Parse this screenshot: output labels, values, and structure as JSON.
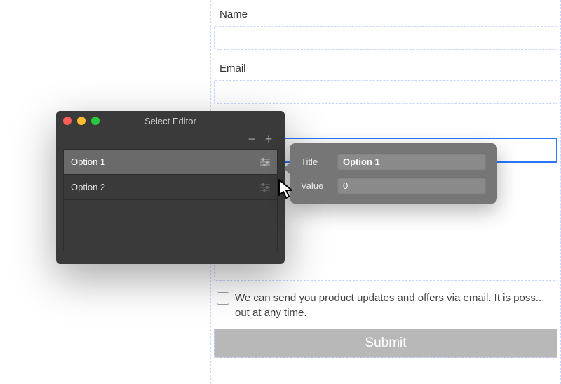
{
  "form": {
    "name_label": "Name",
    "email_label": "Email",
    "checkbox_text": "We can send you product updates and offers via email. It is poss... out at any time.",
    "submit_label": "Submit"
  },
  "editor": {
    "window_title": "Select Editor",
    "options": [
      {
        "label": "Option 1"
      },
      {
        "label": "Option 2"
      }
    ]
  },
  "popover": {
    "title_label": "Title",
    "title_value": "Option 1",
    "value_label": "Value",
    "value_value": "0"
  },
  "colors": {
    "editor_bg": "#3a3a3a",
    "popover_bg": "#767676",
    "form_dashed": "#c8d5ff",
    "highlight_border": "#2a76ff",
    "submit_bg": "#b8b8b8"
  }
}
